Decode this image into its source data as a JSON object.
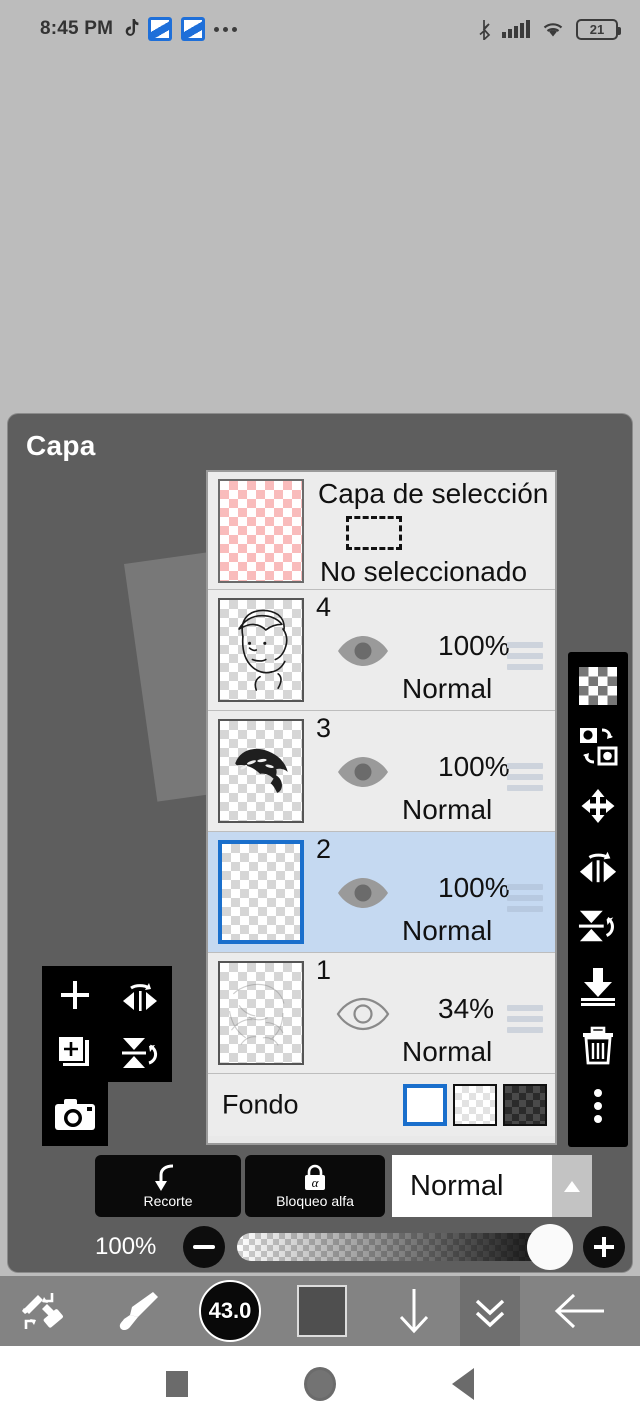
{
  "status_bar": {
    "time": "8:45 PM",
    "app_icons": [
      "tiktok-icon",
      "app-icon-1",
      "app-icon-2",
      "overflow-dots-icon"
    ],
    "bluetooth": "bluetooth-icon",
    "signal": "cellular-signal-icon",
    "wifi": "wifi-icon",
    "battery_percent": "21"
  },
  "sheet": {
    "title": "Capa"
  },
  "layers": {
    "selection_layer": {
      "title": "Capa de selección",
      "status": "No seleccionado",
      "thumb": "pink-checker-thumb"
    },
    "rows": [
      {
        "number": "4",
        "opacity": "100%",
        "blend": "Normal",
        "visible": true,
        "selected": false,
        "thumb": "face-lineart-thumb"
      },
      {
        "number": "3",
        "opacity": "100%",
        "blend": "Normal",
        "visible": true,
        "selected": false,
        "thumb": "hair-strokes-thumb"
      },
      {
        "number": "2",
        "opacity": "100%",
        "blend": "Normal",
        "visible": true,
        "selected": true,
        "thumb": "empty-thumb"
      },
      {
        "number": "1",
        "opacity": "34%",
        "blend": "Normal",
        "visible": false,
        "selected": false,
        "thumb": "sketch-thumb"
      }
    ],
    "background_row": {
      "label": "Fondo",
      "swatches": [
        "white-swatch",
        "light-checker-swatch",
        "dark-checker-swatch"
      ],
      "selected_swatch_index": 0
    }
  },
  "controls": {
    "clip_label": "Recorte",
    "alpha_lock_label": "Bloqueo alfa",
    "blend_mode": "Normal",
    "blend_expand_icon": "chevron-up-icon",
    "opacity_value": "100%",
    "minus_icon": "minus-icon",
    "plus_icon": "plus-icon"
  },
  "left_tools": [
    "add-layer-plus-icon",
    "flip-horizontal-rotate-icon",
    "duplicate-layer-icon",
    "flip-vertical-rotate-icon",
    "camera-import-icon"
  ],
  "right_tools": [
    "transparency-checker-icon",
    "transform-copy-icon",
    "move-arrows-icon",
    "flip-horizontal-icon",
    "flip-vertical-icon",
    "merge-down-icon",
    "delete-trash-icon",
    "more-vertical-icon"
  ],
  "bottom_bar": {
    "items": [
      {
        "name": "undo-redo-eraser-tool",
        "active": false
      },
      {
        "name": "brush-tool",
        "active": false
      },
      {
        "name": "brush-size-indicator",
        "active": false,
        "value": "43.0"
      },
      {
        "name": "color-swatch",
        "active": false
      },
      {
        "name": "download-arrow-tool",
        "active": false
      },
      {
        "name": "collapse-double-chevron",
        "active": true
      },
      {
        "name": "back-arrow",
        "active": false
      }
    ]
  },
  "nav_bar": {
    "items": [
      "recents-square-icon",
      "home-circle-icon",
      "back-triangle-icon"
    ]
  },
  "colors": {
    "accent_blue": "#1a6fcc",
    "selected_row": "#c5d9f1",
    "panel_bg": "#5e5e5e",
    "desktop_bg": "#bcbcbc",
    "list_bg": "#ececec"
  }
}
